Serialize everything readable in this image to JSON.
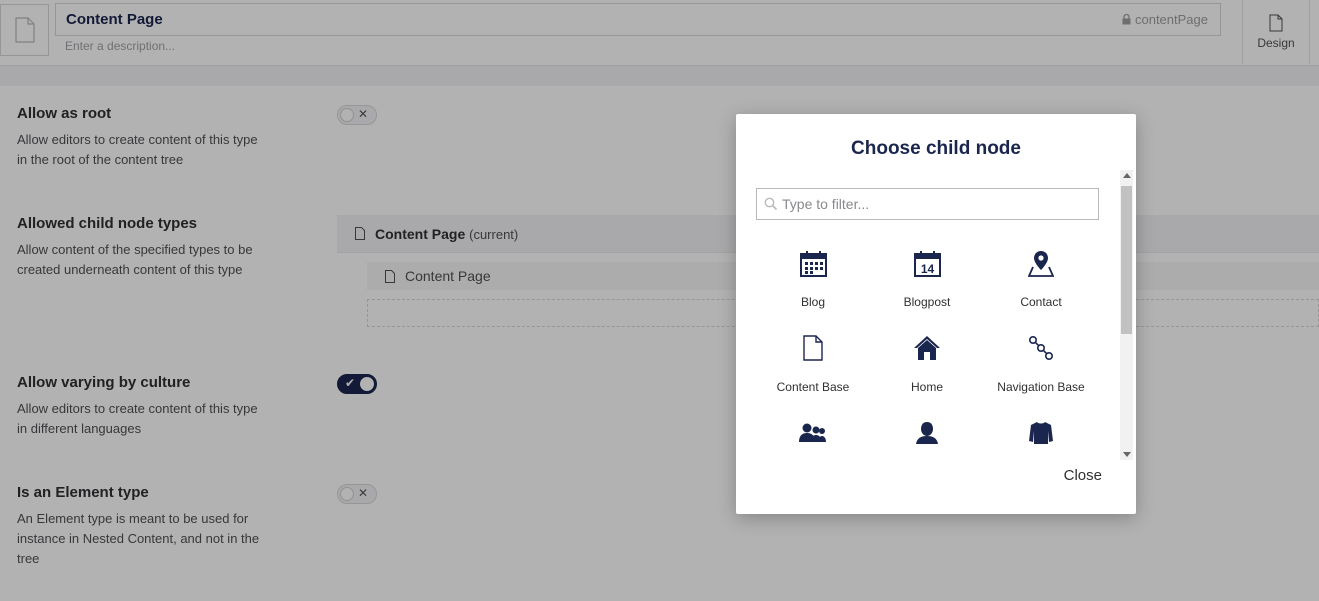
{
  "header": {
    "name": "Content Page",
    "alias": "contentPage",
    "description_placeholder": "Enter a description...",
    "design_tab": "Design"
  },
  "settings": {
    "allow_root": {
      "title": "Allow as root",
      "description": "Allow editors to create content of this type in the root of the content tree",
      "enabled": false
    },
    "allowed_children": {
      "title": "Allowed child node types",
      "description": "Allow content of the specified types to be created underneath content of this type",
      "current_name": "Content Page",
      "current_tag": "(current)",
      "items": [
        "Content Page"
      ]
    },
    "vary_culture": {
      "title": "Allow varying by culture",
      "description": "Allow editors to create content of this type in different languages",
      "enabled": true
    },
    "element_type": {
      "title": "Is an Element type",
      "description": "An Element type is meant to be used for instance in Nested Content, and not in the tree",
      "enabled": false
    }
  },
  "toggle_marks": {
    "off": "✕",
    "on": "✔"
  },
  "modal": {
    "title": "Choose child node",
    "filter_placeholder": "Type to filter...",
    "close_label": "Close",
    "items": [
      {
        "label": "Blog",
        "icon": "calendar-icon"
      },
      {
        "label": "Blogpost",
        "icon": "calendar-14-icon"
      },
      {
        "label": "Contact",
        "icon": "map-location-icon"
      },
      {
        "label": "Content Base",
        "icon": "document-icon"
      },
      {
        "label": "Home",
        "icon": "home-icon"
      },
      {
        "label": "Navigation Base",
        "icon": "sitemap-icon"
      },
      {
        "label": "",
        "icon": "users-icon"
      },
      {
        "label": "",
        "icon": "user-icon"
      },
      {
        "label": "",
        "icon": "shirt-icon"
      }
    ],
    "calendar_day": "14"
  },
  "colors": {
    "primary": "#1b264f",
    "overlay": "rgba(0,0,0,0.30)"
  }
}
